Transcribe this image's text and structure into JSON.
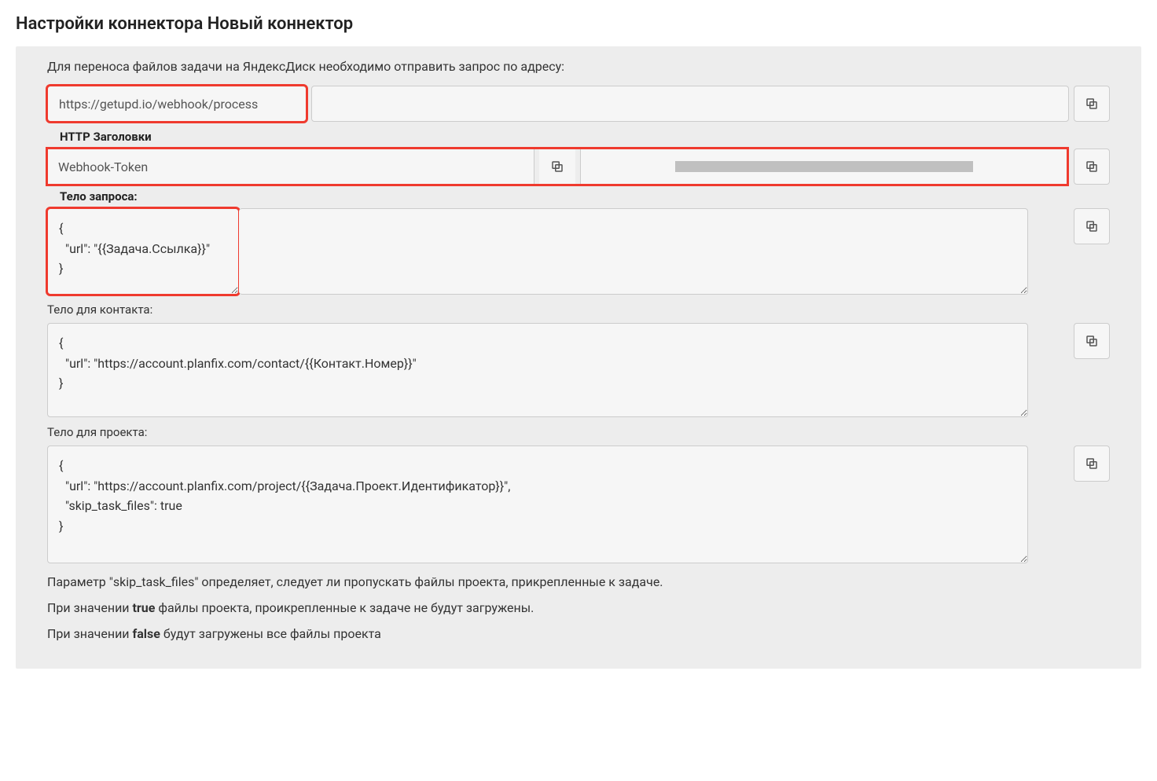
{
  "title": "Настройки коннектора Новый коннектор",
  "intro": "Для переноса файлов задачи на ЯндексДиск необходимо отправить запрос по адресу:",
  "url_value": "https://getupd.io/webhook/process",
  "headers_label": "HTTP Заголовки",
  "header_name": "Webhook-Token",
  "header_value_redacted": true,
  "body_label": "Тело запроса:",
  "body_task": "{\n  \"url\": \"{{Задача.Ссылка}}\"\n}",
  "body_contact_label": "Тело для контакта:",
  "body_contact": "{\n  \"url\": \"https://account.planfix.com/contact/{{Контакт.Номер}}\"\n}",
  "body_project_label": "Тело для проекта:",
  "body_project": "{\n  \"url\": \"https://account.planfix.com/project/{{Задача.Проект.Идентификатор}}\",\n  \"skip_task_files\": true\n}",
  "notes": {
    "line1_pre": "Параметр \"skip_task_files\" определяет, следует ли пропускать файлы проекта, прикрепленные к задаче.",
    "line2_pre": "При значении ",
    "line2_bold": "true",
    "line2_post": " файлы проекта, проикрепленные к задаче не будут загружены.",
    "line3_pre": "При значении ",
    "line3_bold": "false",
    "line3_post": " будут загружены все файлы проекта"
  }
}
